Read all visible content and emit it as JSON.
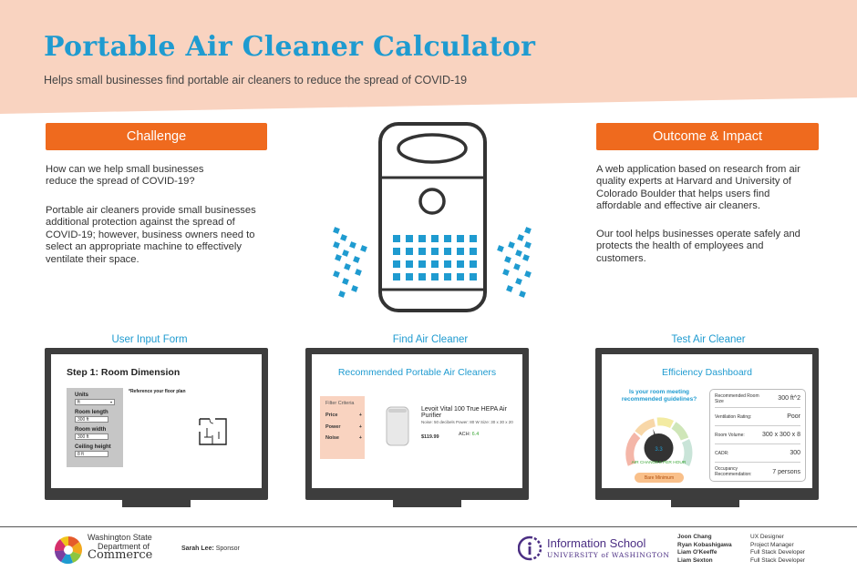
{
  "header": {
    "title": "Portable Air Cleaner Calculator",
    "subtitle": "Helps small businesses find portable air cleaners to reduce the spread of COVID-19"
  },
  "challenge": {
    "heading": "Challenge",
    "p1": "How can we help small businesses reduce the spread of COVID-19?",
    "p2": "Portable air cleaners provide small businesses additional protection against the spread of COVID-19; however, business owners need to select an appropriate machine to effectively ventilate their space."
  },
  "outcome": {
    "heading": "Outcome & Impact",
    "p1": "A web application based on research from air quality experts at Harvard and University of Colorado Boulder that helps users find affordable and effective air cleaners.",
    "p2": "Our tool helps businesses operate safely and protects the health of employees and customers."
  },
  "sections": {
    "input_form": "User Input Form",
    "find": "Find Air Cleaner",
    "test": "Test Air Cleaner"
  },
  "screen1": {
    "heading": "Step 1: Room Dimension",
    "units_label": "Units",
    "units_value": "ft",
    "length_label": "Room length",
    "length_value": "300  ft",
    "width_label": "Room width",
    "width_value": "300  ft",
    "height_label": "Ceiling height",
    "height_value": "8  ft",
    "reference": "*Reference your floor plan"
  },
  "screen2": {
    "heading": "Recommended Portable Air Cleaners",
    "filter_title": "Filter Criteria",
    "filters": [
      "Price",
      "Power",
      "Noise"
    ],
    "product_name": "Levoit Vital 100 True HEPA Air Purifier",
    "specs": "Noise: 50 decibels    Power: 80 W    Size: 30 x 30 x 20",
    "price": "$119.99",
    "ach_label": "ACH:",
    "ach_value": "6.4"
  },
  "screen3": {
    "heading": "Efficiency Dashboard",
    "question": "Is your room meeting recommended guidelines?",
    "gauge_value": "3.3",
    "gauge_label": "AIR CHANGES PER HOUR",
    "gauge_level": 0.45,
    "bare_minimum": "Bare Minimum",
    "rows": [
      {
        "label": "Recommended Room Size",
        "value": "300 ft^2"
      },
      {
        "label": "Ventilation Rating:",
        "value": "Poor"
      },
      {
        "label": "Room Volume:",
        "value": "300 x 300 x 8"
      },
      {
        "label": "CADR:",
        "value": "300"
      },
      {
        "label": "Occupancy Recommendation:",
        "value": "7 persons"
      }
    ]
  },
  "footer": {
    "commerce_line1": "Washington State",
    "commerce_line2": "Department of",
    "commerce_line3": "Commerce",
    "sponsor_name": "Sarah Lee:",
    "sponsor_role": " Sponsor",
    "ischool_line1": "Information School",
    "ischool_line2": "UNIVERSITY of WASHINGTON",
    "team": [
      {
        "name": "Joon Chang",
        "role": "UX Designer"
      },
      {
        "name": "Ryan Kobashigawa",
        "role": "Project Manager"
      },
      {
        "name": "Liam O'Keeffe",
        "role": "Full Stack Developer"
      },
      {
        "name": "Liam Sexton",
        "role": "Full Stack Developer"
      }
    ]
  },
  "colors": {
    "accent_blue": "#1f9bd0",
    "orange": "#ef6a1e",
    "header_bg": "#f9d3c0",
    "monitor": "#3d3d3d"
  }
}
